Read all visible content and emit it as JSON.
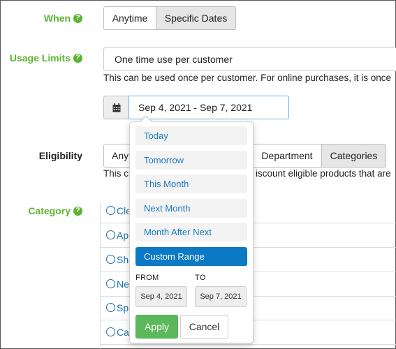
{
  "when": {
    "label": "When",
    "options": [
      "Anytime",
      "Specific Dates"
    ],
    "selected": "Specific Dates"
  },
  "usage_limits": {
    "label": "Usage Limits",
    "value": "One time use per customer",
    "help_text": "This can be used once per customer. For online purchases, it is once"
  },
  "date_range": {
    "value": "Sep 4, 2021 - Sep 7, 2021",
    "icon": "calendar-icon"
  },
  "eligibility": {
    "label": "Eligibility",
    "options": [
      "Any",
      "Department",
      "Categories"
    ],
    "selected": "Categories",
    "help_text_left": "This c",
    "help_text_right": "iscount eligible products that are"
  },
  "category": {
    "label": "Category",
    "items": [
      "Cle",
      "Ap",
      "Sh",
      "Ne",
      "Sp",
      "Ca"
    ]
  },
  "picker": {
    "ranges": [
      "Today",
      "Tomorrow",
      "This Month",
      "Next Month",
      "Month After Next",
      "Custom Range"
    ],
    "active_range": "Custom Range",
    "from_label": "FROM",
    "to_label": "TO",
    "from_value": "Sep 4, 2021",
    "to_value": "Sep 7, 2021",
    "apply_label": "Apply",
    "cancel_label": "Cancel"
  },
  "colors": {
    "label_green": "#5cb531",
    "link_blue": "#1a7bbf",
    "active_range_bg": "#0c79c4",
    "apply_bg": "#5cb85c"
  }
}
